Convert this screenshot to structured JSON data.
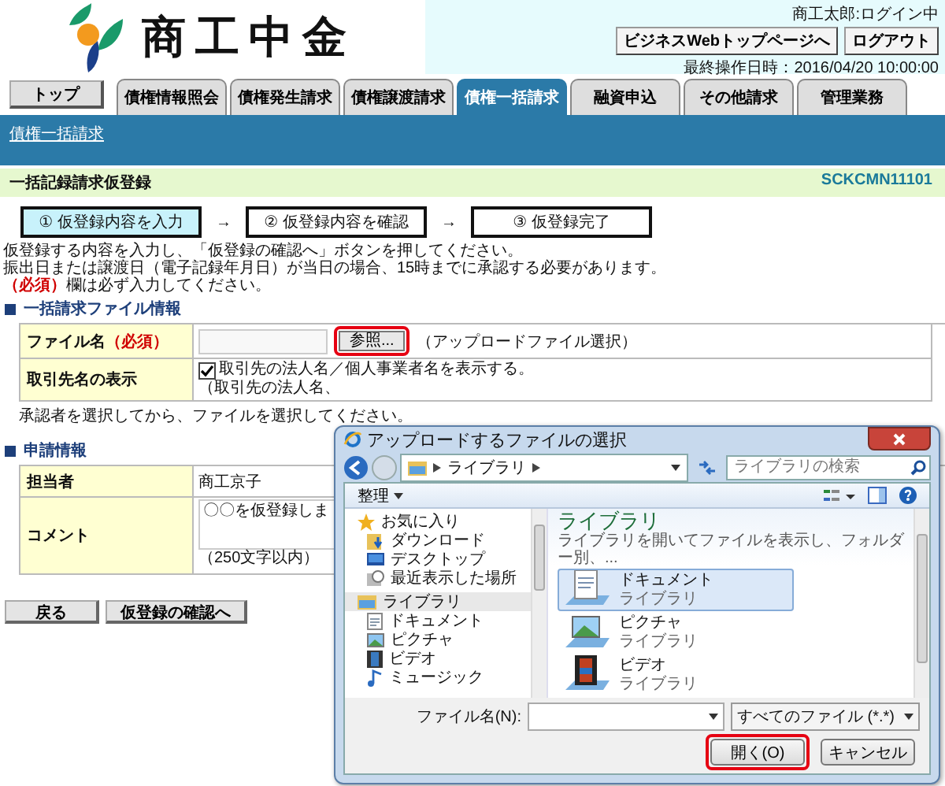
{
  "header": {
    "logo_text": "商工中金",
    "user_status": "商工太郎:ログイン中",
    "buttons": [
      "ビジネスWebトップページへ",
      "ログアウト"
    ],
    "last_operation": "最終操作日時：2016/04/20 10:00:00"
  },
  "top_button": "トップ",
  "tabs": [
    {
      "label": "債権情報照会",
      "selected": false
    },
    {
      "label": "債権発生請求",
      "selected": false
    },
    {
      "label": "債権譲渡請求",
      "selected": false
    },
    {
      "label": "債権一括請求",
      "selected": true
    },
    {
      "label": "融資申込",
      "selected": false
    },
    {
      "label": "その他請求",
      "selected": false
    },
    {
      "label": "管理業務",
      "selected": false
    }
  ],
  "breadcrumb": "債権一括請求",
  "page": {
    "title": "一括記録請求仮登録",
    "screen_id": "SCKCMN11101"
  },
  "steps": [
    {
      "label": "① 仮登録内容を入力",
      "selected": true
    },
    {
      "label": "② 仮登録内容を確認",
      "selected": false
    },
    {
      "label": "③ 仮登録完了",
      "selected": false
    }
  ],
  "step_arrows": [
    "→",
    "→"
  ],
  "instructions": [
    "仮登録する内容を入力し、「仮登録の確認へ」ボタンを押してください。",
    "振出日または譲渡日（電子記録年月日）が当日の場合、15時までに承認する必要があります。"
  ],
  "required_note": {
    "mark": "（必須）",
    "text": "欄は必ず入力してください。"
  },
  "file_section": {
    "heading": "一括請求ファイル情報",
    "file_row": {
      "label": "ファイル名",
      "required_mark": "（必須）",
      "browse_button": {
        "label": "参照...",
        "highlighted": true
      },
      "hint": "（アップロードファイル選択）"
    },
    "display_row": {
      "label": "取引先名の表示",
      "checkbox": {
        "label": "取引先の法人名／個人事業者名を表示する。",
        "checked": true
      },
      "note": "（取引先の法人名、"
    },
    "note": "承認者を選択してから、ファイルを選択してください。"
  },
  "application_section": {
    "heading": "申請情報",
    "rows": [
      {
        "label": "担当者",
        "value": "商工京子"
      }
    ],
    "comment": {
      "label": "コメント",
      "value": "〇〇を仮登録しま",
      "limit": "（250文字以内）"
    }
  },
  "buttons": [
    "戻る",
    "仮登録の確認へ"
  ],
  "dialog": {
    "title": "アップロードするファイルの選択",
    "path": "ライブラリ",
    "search_placeholder": "ライブラリの検索",
    "organize": "整理",
    "nav": [
      {
        "label": "お気に入り",
        "kind": "favorites",
        "selected": false,
        "children": [
          {
            "label": "ダウンロード",
            "kind": "download",
            "selected": false
          },
          {
            "label": "デスクトップ",
            "kind": "desktop",
            "selected": false
          },
          {
            "label": "最近表示した場所",
            "kind": "recent",
            "selected": false
          }
        ]
      },
      {
        "label": "ライブラリ",
        "kind": "library",
        "selected": true,
        "children": [
          {
            "label": "ドキュメント",
            "kind": "document",
            "selected": false
          },
          {
            "label": "ピクチャ",
            "kind": "picture",
            "selected": false
          },
          {
            "label": "ビデオ",
            "kind": "video",
            "selected": false
          },
          {
            "label": "ミュージック",
            "kind": "music",
            "selected": false
          }
        ]
      }
    ],
    "content": {
      "heading": "ライブラリ",
      "description": "ライブラリを開いてファイルを表示し、フォルダー別、...",
      "items": [
        {
          "name": "ドキュメント",
          "type": "ライブラリ",
          "kind": "document",
          "selected": true
        },
        {
          "name": "ピクチャ",
          "type": "ライブラリ",
          "kind": "picture",
          "selected": false
        },
        {
          "name": "ビデオ",
          "type": "ライブラリ",
          "kind": "video",
          "selected": false
        }
      ]
    },
    "filename_label": "ファイル名(N):",
    "filetype": "すべてのファイル (*.*)",
    "buttons": [
      {
        "label": "開く(O)",
        "highlighted": true
      },
      {
        "label": "キャンセル",
        "highlighted": false
      }
    ]
  }
}
